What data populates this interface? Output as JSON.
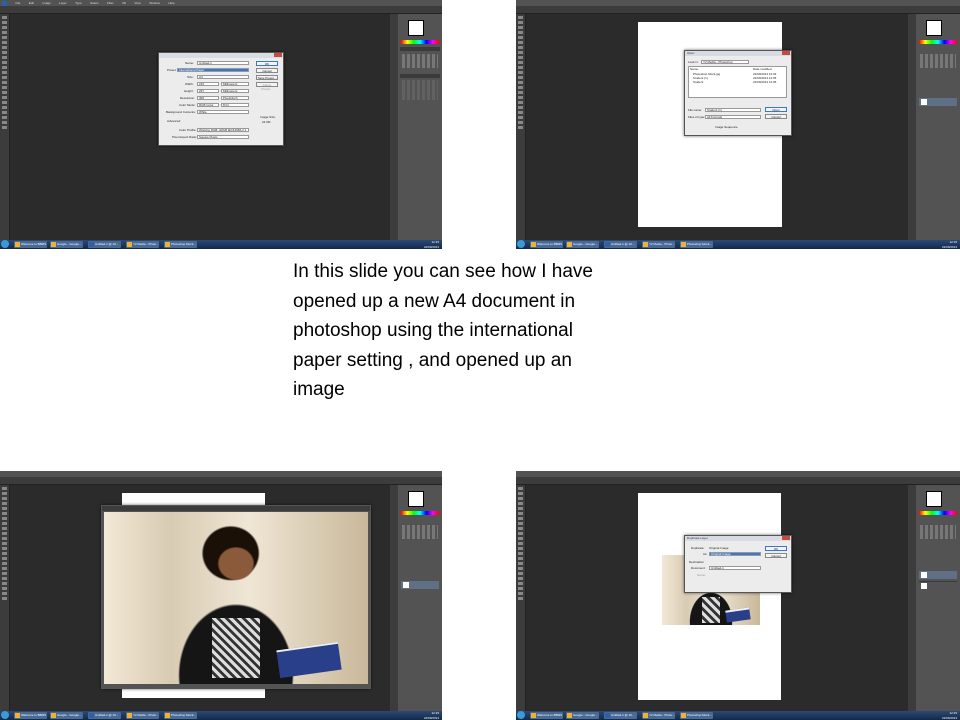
{
  "caption": {
    "lines": [
      "In this slide you can see how I have",
      "opened up a new A4 document in",
      "photoshop using the international",
      "paper setting , and opened up an",
      "image"
    ]
  },
  "menu_items": [
    "File",
    "Edit",
    "Image",
    "Layer",
    "Type",
    "Select",
    "Filter",
    "3D",
    "View",
    "Window",
    "Help"
  ],
  "colors": {
    "workspace": "#2b2b2b",
    "panel": "#535353",
    "taskbar": "#1c3a66",
    "selection": "#3a78d0"
  },
  "icons": [
    "photoshop-icon",
    "windows-start-icon",
    "folder-icon",
    "chrome-icon"
  ],
  "screens": {
    "new_doc": {
      "dialog_rows": [
        {
          "label": "Name:",
          "value": "Untitled-1"
        },
        {
          "label": "Preset:",
          "value": "International Paper"
        },
        {
          "label": "Size:",
          "value": "A4"
        },
        {
          "label": "Width:",
          "value": "210",
          "unit": "Millimeters"
        },
        {
          "label": "Height:",
          "value": "297",
          "unit": "Millimeters"
        },
        {
          "label": "Resolution:",
          "value": "300",
          "unit": "Pixels/Inch"
        },
        {
          "label": "Color Mode:",
          "value": "RGB Color",
          "unit": "8 bit"
        },
        {
          "label": "Background Contents:",
          "value": "White"
        },
        {
          "label": "Color Profile:",
          "value": "Working RGB: sRGB IEC61966-2.1"
        },
        {
          "label": "Pixel Aspect Ratio:",
          "value": "Square Pixels"
        }
      ],
      "advanced": "Advanced",
      "buttons": [
        "OK",
        "Cancel",
        "Save Preset...",
        "Delete Preset..."
      ],
      "image_size_label": "Image Size:",
      "image_size_value": "24.9M"
    },
    "open_dialog": {
      "title": "Open",
      "look_in_label": "Look in:",
      "look_in_value": "Y2 Media - Photoshop",
      "columns": [
        "Name",
        "Date modified"
      ],
      "files": [
        {
          "name": "Photoshop Mock.jpg",
          "date": "22/09/2013 12:03"
        },
        {
          "name": "Student (1)",
          "date": "22/09/2013 12:05"
        },
        {
          "name": "Student",
          "date": "22/09/2013 12:05"
        }
      ],
      "file_name_label": "File name:",
      "file_name_value": "Student (1)",
      "files_type_label": "Files of type:",
      "files_type_value": "All Formats",
      "image_sequence": "Image Sequence",
      "buttons": [
        "Open",
        "Cancel"
      ]
    },
    "duplicate_dialog": {
      "title": "Duplicate Layer",
      "duplicate_label": "Duplicate:",
      "duplicate_value": "Original Image",
      "as_label": "As:",
      "as_value": "Original Image",
      "destination_label": "Destination",
      "document_label": "Document:",
      "document_value": "Untitled-1",
      "name_label": "Name:",
      "buttons": [
        "OK",
        "Cancel"
      ]
    },
    "layers": {
      "background": "Background",
      "original_image": "Original Image"
    },
    "taskbar": {
      "buttons": [
        "Welcome to BBMS",
        "Google - Google...",
        "Untitled-1 @ 16...",
        "Y2 Media - Photo...",
        "Photoshop Mock..."
      ],
      "time": "12:15",
      "date": "22/09/2013"
    }
  }
}
